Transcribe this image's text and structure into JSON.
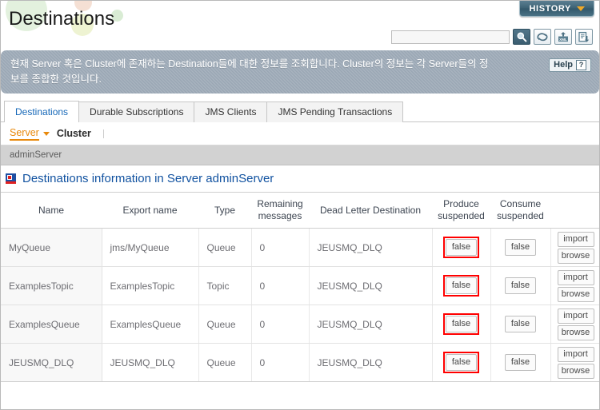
{
  "header": {
    "title": "Destinations",
    "history_label": "HISTORY",
    "history_icon": "chevron-down-icon"
  },
  "toolbar": {
    "search_value": "",
    "search_placeholder": "",
    "buttons": [
      {
        "name": "search-icon",
        "label": "\u0000"
      },
      {
        "name": "refresh-icon",
        "label": ""
      },
      {
        "name": "xml-upload-icon",
        "label": "XML"
      },
      {
        "name": "export-icon",
        "label": ""
      }
    ]
  },
  "banner": {
    "text": "현재 Server 혹은 Cluster에 존재하는 Destination들에 대한 정보를 조회합니다. Cluster의 정보는 각 Server들의 정보를 종합한 것입니다.",
    "help_label": "Help",
    "help_icon": "question-mark-icon"
  },
  "tabs": [
    {
      "label": "Destinations",
      "active": true
    },
    {
      "label": "Durable Subscriptions",
      "active": false
    },
    {
      "label": "JMS Clients",
      "active": false
    },
    {
      "label": "JMS Pending Transactions",
      "active": false
    }
  ],
  "subnav": [
    {
      "label": "Server",
      "active": true
    },
    {
      "label": "Cluster",
      "active": false
    }
  ],
  "breadcrumb": {
    "text": "adminServer"
  },
  "section": {
    "icon": "flag-icon",
    "title": "Destinations information in Server adminServer"
  },
  "table": {
    "columns": [
      "Name",
      "Export name",
      "Type",
      "Remaining messages",
      "Dead Letter Destination",
      "Produce suspended",
      "Consume suspended",
      ""
    ],
    "rows": [
      {
        "name": "MyQueue",
        "export_name": "jms/MyQueue",
        "type": "Queue",
        "remaining_messages": "0",
        "dead_letter_destination": "JEUSMQ_DLQ",
        "produce_suspended": "false",
        "consume_suspended": "false",
        "import_label": "import",
        "browse_label": "browse"
      },
      {
        "name": "ExamplesTopic",
        "export_name": "ExamplesTopic",
        "type": "Topic",
        "remaining_messages": "0",
        "dead_letter_destination": "JEUSMQ_DLQ",
        "produce_suspended": "false",
        "consume_suspended": "false",
        "import_label": "import",
        "browse_label": "browse"
      },
      {
        "name": "ExamplesQueue",
        "export_name": "ExamplesQueue",
        "type": "Queue",
        "remaining_messages": "0",
        "dead_letter_destination": "JEUSMQ_DLQ",
        "produce_suspended": "false",
        "consume_suspended": "false",
        "import_label": "import",
        "browse_label": "browse"
      },
      {
        "name": "JEUSMQ_DLQ",
        "export_name": "JEUSMQ_DLQ",
        "type": "Queue",
        "remaining_messages": "0",
        "dead_letter_destination": "JEUSMQ_DLQ",
        "produce_suspended": "false",
        "consume_suspended": "false",
        "import_label": "import",
        "browse_label": "browse"
      }
    ]
  },
  "colors": {
    "accent_blue": "#1668b8",
    "heading_blue": "#1152a0",
    "active_orange": "#e8890c",
    "highlight_red": "#ff0000",
    "banner_gray": "#9aa7b4",
    "history_teal": "#3d6274"
  }
}
